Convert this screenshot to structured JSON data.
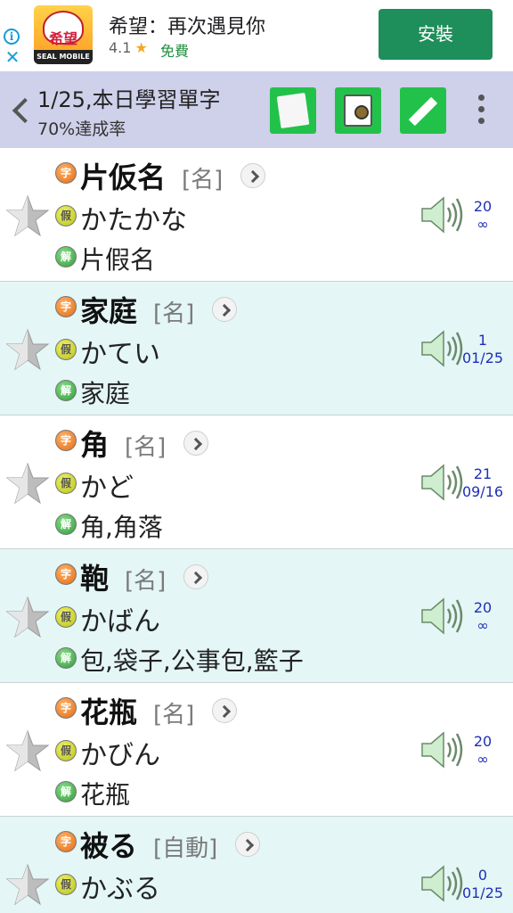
{
  "ad": {
    "app_name": "希望：再次遇見你",
    "rating": "4.1",
    "rating_star": "★",
    "price": "免費",
    "install_label": "安裝",
    "info_icon": "i",
    "close_icon": "✕",
    "logo_text": "希望",
    "logo_brand": "SEAL MOBILE"
  },
  "toolbar": {
    "title": "1/25,本日學習單字",
    "subtitle": "70%達成率",
    "buttons": [
      "notes-icon",
      "flashcards-icon",
      "edit-icon"
    ],
    "accent_color": "#22c24a",
    "bar_color": "#cfd0ea"
  },
  "badges": {
    "kanji": "字",
    "kana": "假",
    "meaning": "解"
  },
  "rows": [
    {
      "word": "片仮名",
      "pos": "[名]",
      "reading": "かたかな",
      "meaning": "片假名",
      "count_top": "20",
      "count_bottom": "∞"
    },
    {
      "word": "家庭",
      "pos": "[名]",
      "reading": "かてい",
      "meaning": "家庭",
      "count_top": "1",
      "count_bottom": "01/25"
    },
    {
      "word": "角",
      "pos": "[名]",
      "reading": "かど",
      "meaning": "角,角落",
      "count_top": "21",
      "count_bottom": "09/16"
    },
    {
      "word": "鞄",
      "pos": "[名]",
      "reading": "かばん",
      "meaning": "包,袋子,公事包,籃子",
      "count_top": "20",
      "count_bottom": "∞"
    },
    {
      "word": "花瓶",
      "pos": "[名]",
      "reading": "かびん",
      "meaning": "花瓶",
      "count_top": "20",
      "count_bottom": "∞"
    },
    {
      "word": "被る",
      "pos": "[自動]",
      "reading": "かぶる",
      "meaning": "",
      "count_top": "0",
      "count_bottom": "01/25"
    }
  ]
}
